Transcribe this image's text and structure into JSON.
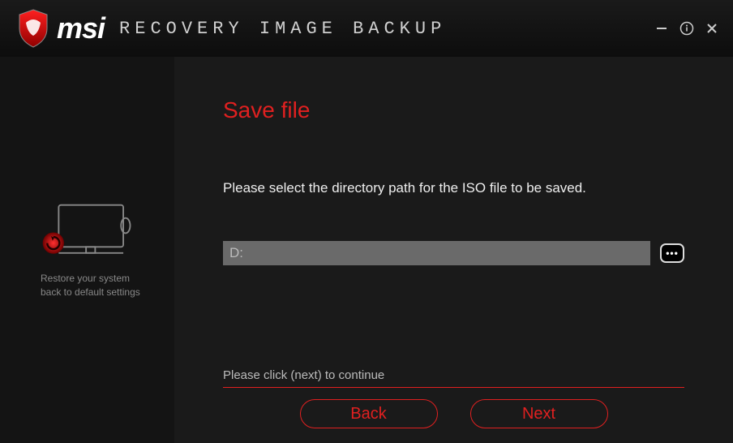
{
  "header": {
    "brand": "msi",
    "title": "RECOVERY IMAGE BACKUP"
  },
  "sidebar": {
    "caption_line1": "Restore your system",
    "caption_line2": "back to default settings"
  },
  "main": {
    "title": "Save file",
    "instruction": "Please select the directory path for the ISO file to be saved.",
    "path_value": "D:",
    "browse_label": "•••",
    "hint": "Please click (next) to continue",
    "back_label": "Back",
    "next_label": "Next"
  },
  "colors": {
    "accent": "#e02020"
  }
}
